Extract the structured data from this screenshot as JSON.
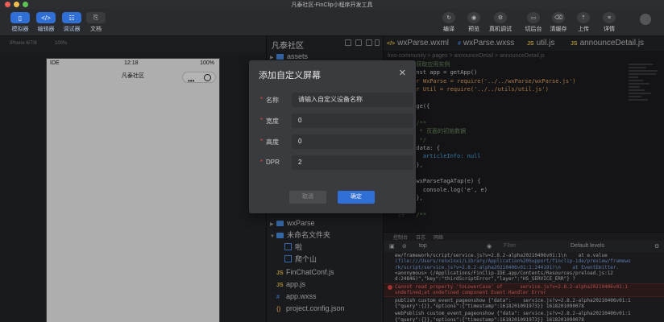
{
  "window": {
    "title": "凡泰社区-FinClip小程序开发工具"
  },
  "toolbar": {
    "left_buttons": [
      {
        "label": "模拟器",
        "icon": "phone-icon"
      },
      {
        "label": "编辑器",
        "icon": "code-icon"
      },
      {
        "label": "调试器",
        "icon": "grid-icon"
      },
      {
        "label": "文档",
        "icon": "document-icon"
      }
    ],
    "right_buttons": [
      {
        "label": "编译",
        "icon": "refresh-icon"
      },
      {
        "label": "预览",
        "icon": "eye-icon"
      },
      {
        "label": "真机调试",
        "icon": "debug-icon"
      },
      {
        "label": "切后台",
        "icon": "background-icon"
      },
      {
        "label": "清缓存",
        "icon": "clear-icon"
      },
      {
        "label": "上传",
        "icon": "upload-icon"
      },
      {
        "label": "详情",
        "icon": "details-icon"
      }
    ]
  },
  "simulator": {
    "device": "iPhone 6/7/8",
    "zoom": "100%",
    "status_carrier": "IDE",
    "status_time": "12:18",
    "status_battery": "100%",
    "nav_title": "凡泰社区",
    "capsule_dots": "•••"
  },
  "file_tree": {
    "project_name": "凡泰社区",
    "items": [
      {
        "label": "assets",
        "type": "folder"
      },
      {
        "label": "wxParse",
        "type": "folder"
      },
      {
        "label": "未命名文件夹",
        "type": "folder"
      },
      {
        "label": "啦",
        "type": "page"
      },
      {
        "label": "爬个山",
        "type": "page"
      },
      {
        "label": "FinChatConf.js",
        "type": "js"
      },
      {
        "label": "app.js",
        "type": "js"
      },
      {
        "label": "app.wxss",
        "type": "css"
      },
      {
        "label": "project.config.json",
        "type": "json"
      }
    ]
  },
  "editor": {
    "tabs": [
      {
        "label": "wxParse.wxml",
        "tag": "</>",
        "color": "#e8c14a"
      },
      {
        "label": "wxParse.wxss",
        "tag": "#",
        "color": "#4a8fe7"
      },
      {
        "label": "util.js",
        "tag": "JS",
        "color": "#e8c14a"
      },
      {
        "label": "announceDetail.js",
        "tag": "JS",
        "color": "#e8c14a"
      }
    ],
    "breadcrumb": "fino-community  >  pages  >  announceDetail  >  announceDetail.js",
    "code_lines": [
      {
        "n": "1",
        "text": "//获取应用实例",
        "cls": "c-com"
      },
      {
        "n": "2",
        "text": "const app = getApp()",
        "cls": "c-fn"
      },
      {
        "n": "3",
        "text": "var WxParse = require('../../wxParse/wxParse.js')",
        "cls": "c-var"
      },
      {
        "n": "4",
        "text": "var Util = require('../../utils/util.js')",
        "cls": "c-var"
      },
      {
        "n": "5",
        "text": "",
        "cls": "c-fn"
      },
      {
        "n": "6",
        "text": "Page({",
        "cls": "c-fn"
      },
      {
        "n": "7",
        "text": "",
        "cls": "c-fn"
      },
      {
        "n": "8",
        "text": "  /**",
        "cls": "c-com"
      },
      {
        "n": "9",
        "text": "   * 页面的初始数据",
        "cls": "c-com"
      },
      {
        "n": "10",
        "text": "   */",
        "cls": "c-com"
      },
      {
        "n": "11",
        "text": "  data: {",
        "cls": "c-fn"
      },
      {
        "n": "12",
        "text": "    articleInfo: null",
        "cls": "c-bool"
      },
      {
        "n": "13",
        "text": "  },",
        "cls": "c-fn"
      },
      {
        "n": "14",
        "text": "",
        "cls": "c-fn"
      },
      {
        "n": "15",
        "text": "  wxParseTagATap(e) {",
        "cls": "c-fn"
      },
      {
        "n": "16",
        "text": "    console.log('e', e)",
        "cls": "c-fn"
      },
      {
        "n": "17",
        "text": "  },",
        "cls": "c-fn"
      },
      {
        "n": "18",
        "text": "",
        "cls": "c-fn"
      },
      {
        "n": "19",
        "text": "  /**",
        "cls": "c-com"
      }
    ]
  },
  "console": {
    "tabs": [
      "控制台",
      "日志",
      "网络"
    ],
    "context": "top",
    "filter_placeholder": "Filter",
    "levels": "Default levels",
    "logs": [
      {
        "text": "ew/framework/script/service.js?v=2.8.2-alpha20210406v01:1\\n    at e.value",
        "kind": "normal"
      },
      {
        "text": "(file:///Users/renxinxi/Library/Application%20Support/finclip-ide/preview/framewo",
        "kind": "link"
      },
      {
        "text": "rk/script/service.js?v=2.8.2-alpha20210406v01:1:244191)\\n    at EventEmitter.",
        "kind": "link"
      },
      {
        "text": "<anonymous> (/Applications/FinClip-IDE.app/Contents/Resources/preload.js:12",
        "kind": "normal"
      },
      {
        "text": "d:24846)\",\"key\":\"thirdScriptError\",\"layer\":\"HS_SERVICE_ERR\"} ?",
        "kind": "normal"
      },
      {
        "text": "Cannot read property 'toLowerCase' of      service.js?v=2.8.2-alpha20210406v01:1",
        "kind": "error"
      },
      {
        "text": "undefined;at undefined component Event Handler Error",
        "kind": "error"
      },
      {
        "text": "publish custom_event_pageonshow {\"data\":    service.js?v=2.8.2-alpha20210406v01:1",
        "kind": "normal"
      },
      {
        "text": "{\"query\":{}},\"options\":{\"timestamp\":1618201091973}} 1618201090078",
        "kind": "normal"
      },
      {
        "text": "webPublish custom_event_pageonshow {\"data\": service.js?v=2.8.2-alpha20210406v01:1",
        "kind": "normal"
      },
      {
        "text": "{\"query\":{}},\"options\":{\"timestamp\":1618201091973}} 1618201090078",
        "kind": "normal"
      }
    ]
  },
  "modal": {
    "title": "添加自定义屏幕",
    "fields": [
      {
        "label": "名称",
        "value": "",
        "placeholder": "请输入自定义设备名称"
      },
      {
        "label": "宽度",
        "value": "0",
        "placeholder": ""
      },
      {
        "label": "高度",
        "value": "0",
        "placeholder": ""
      },
      {
        "label": "DPR",
        "value": "2",
        "placeholder": ""
      }
    ],
    "cancel_label": "取消",
    "confirm_label": "确定",
    "close_glyph": "✕",
    "required_mark": "*"
  },
  "colors": {
    "accent": "#2f6fd6",
    "error": "#e04646",
    "folder": "#4a8fe7"
  }
}
